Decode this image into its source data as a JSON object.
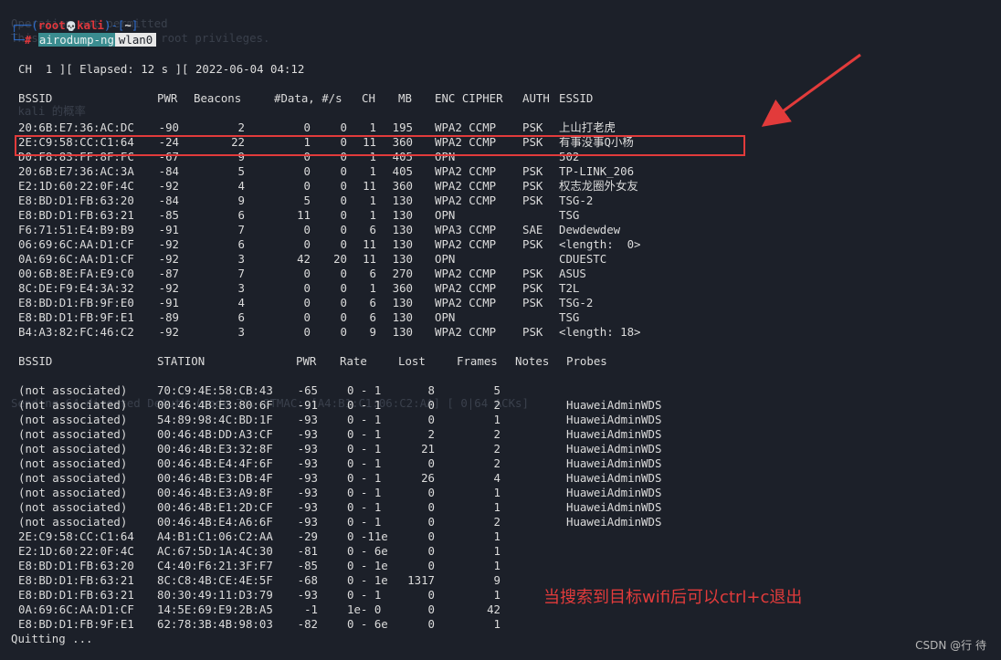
{
  "prompt": {
    "user": "root",
    "skull": "💀",
    "host": "kali",
    "dir": "~",
    "hash": "#",
    "command": "airodump-ng",
    "arg": "wlan0"
  },
  "status_line": "CH  1 ][ Elapsed: 12 s ][ 2022-06-04 04:12",
  "ap_header": [
    "BSSID",
    "PWR",
    "Beacons",
    "#Data, #/s",
    "CH",
    "MB",
    "ENC CIPHER",
    "AUTH",
    "ESSID"
  ],
  "ap_rows": [
    [
      "20:6B:E7:36:AC:DC",
      "-90",
      "2",
      "0",
      "0",
      "1",
      "195",
      "WPA2 CCMP",
      "PSK",
      "上山打老虎"
    ],
    [
      "2E:C9:58:CC:C1:64",
      "-24",
      "22",
      "1",
      "0",
      "11",
      "360",
      "WPA2 CCMP",
      "PSK",
      "有事没事Q小杨"
    ],
    [
      "D0:F8:83:FF:8F:FC",
      "-67",
      "9",
      "0",
      "0",
      "1",
      "405",
      "OPN",
      "",
      "502"
    ],
    [
      "20:6B:E7:36:AC:3A",
      "-84",
      "5",
      "0",
      "0",
      "1",
      "405",
      "WPA2 CCMP",
      "PSK",
      "TP-LINK_206"
    ],
    [
      "E2:1D:60:22:0F:4C",
      "-92",
      "4",
      "0",
      "0",
      "11",
      "360",
      "WPA2 CCMP",
      "PSK",
      "权志龙圈外女友"
    ],
    [
      "E8:BD:D1:FB:63:20",
      "-84",
      "9",
      "5",
      "0",
      "1",
      "130",
      "WPA2 CCMP",
      "PSK",
      "TSG-2"
    ],
    [
      "E8:BD:D1:FB:63:21",
      "-85",
      "6",
      "11",
      "0",
      "1",
      "130",
      "OPN",
      "",
      "TSG"
    ],
    [
      "F6:71:51:E4:B9:B9",
      "-91",
      "7",
      "0",
      "0",
      "6",
      "130",
      "WPA3 CCMP",
      "SAE",
      "Dewdewdew"
    ],
    [
      "06:69:6C:AA:D1:CF",
      "-92",
      "6",
      "0",
      "0",
      "11",
      "130",
      "WPA2 CCMP",
      "PSK",
      "<length:  0>"
    ],
    [
      "0A:69:6C:AA:D1:CF",
      "-92",
      "3",
      "42",
      "20",
      "11",
      "130",
      "OPN",
      "",
      "CDUESTC"
    ],
    [
      "00:6B:8E:FA:E9:C0",
      "-87",
      "7",
      "0",
      "0",
      "6",
      "270",
      "WPA2 CCMP",
      "PSK",
      "ASUS"
    ],
    [
      "8C:DE:F9:E4:3A:32",
      "-92",
      "3",
      "0",
      "0",
      "1",
      "360",
      "WPA2 CCMP",
      "PSK",
      "T2L"
    ],
    [
      "E8:BD:D1:FB:9F:E0",
      "-91",
      "4",
      "0",
      "0",
      "6",
      "130",
      "WPA2 CCMP",
      "PSK",
      "TSG-2"
    ],
    [
      "E8:BD:D1:FB:9F:E1",
      "-89",
      "6",
      "0",
      "0",
      "6",
      "130",
      "OPN",
      "",
      "TSG"
    ],
    [
      "B4:A3:82:FC:46:C2",
      "-92",
      "3",
      "0",
      "0",
      "9",
      "130",
      "WPA2 CCMP",
      "PSK",
      "<length: 18>"
    ]
  ],
  "sta_header": [
    "BSSID",
    "STATION",
    "PWR",
    "Rate",
    "Lost",
    "Frames",
    "Notes",
    "Probes"
  ],
  "sta_rows": [
    [
      "(not associated)",
      "70:C9:4E:58:CB:43",
      "-65",
      "0 - 1",
      "8",
      "5",
      "",
      ""
    ],
    [
      "(not associated)",
      "00:46:4B:E3:80:6F",
      "-91",
      "0 - 1",
      "0",
      "2",
      "",
      "HuaweiAdminWDS"
    ],
    [
      "(not associated)",
      "54:89:98:4C:BD:1F",
      "-93",
      "0 - 1",
      "0",
      "1",
      "",
      "HuaweiAdminWDS"
    ],
    [
      "(not associated)",
      "00:46:4B:DD:A3:CF",
      "-93",
      "0 - 1",
      "2",
      "2",
      "",
      "HuaweiAdminWDS"
    ],
    [
      "(not associated)",
      "00:46:4B:E3:32:8F",
      "-93",
      "0 - 1",
      "21",
      "2",
      "",
      "HuaweiAdminWDS"
    ],
    [
      "(not associated)",
      "00:46:4B:E4:4F:6F",
      "-93",
      "0 - 1",
      "0",
      "2",
      "",
      "HuaweiAdminWDS"
    ],
    [
      "(not associated)",
      "00:46:4B:E3:DB:4F",
      "-93",
      "0 - 1",
      "26",
      "4",
      "",
      "HuaweiAdminWDS"
    ],
    [
      "(not associated)",
      "00:46:4B:E3:A9:8F",
      "-93",
      "0 - 1",
      "0",
      "1",
      "",
      "HuaweiAdminWDS"
    ],
    [
      "(not associated)",
      "00:46:4B:E1:2D:CF",
      "-93",
      "0 - 1",
      "0",
      "1",
      "",
      "HuaweiAdminWDS"
    ],
    [
      "(not associated)",
      "00:46:4B:E4:A6:6F",
      "-93",
      "0 - 1",
      "0",
      "2",
      "",
      "HuaweiAdminWDS"
    ],
    [
      "2E:C9:58:CC:C1:64",
      "A4:B1:C1:06:C2:AA",
      "-29",
      "0 -11e",
      "0",
      "1",
      "",
      ""
    ],
    [
      "E2:1D:60:22:0F:4C",
      "AC:67:5D:1A:4C:30",
      "-81",
      "0 - 6e",
      "0",
      "1",
      "",
      ""
    ],
    [
      "E8:BD:D1:FB:63:20",
      "C4:40:F6:21:3F:F7",
      "-85",
      "0 - 1e",
      "0",
      "1",
      "",
      ""
    ],
    [
      "E8:BD:D1:FB:63:21",
      "8C:C8:4B:CE:4E:5F",
      "-68",
      "0 - 1e",
      "1317",
      "9",
      "",
      ""
    ],
    [
      "E8:BD:D1:FB:63:21",
      "80:30:49:11:D3:79",
      "-93",
      "0 - 1",
      "0",
      "1",
      "",
      ""
    ],
    [
      "0A:69:6C:AA:D1:CF",
      "14:5E:69:E9:2B:A5",
      "-1",
      "1e- 0",
      "0",
      "42",
      "",
      ""
    ],
    [
      "E8:BD:D1:FB:9F:E1",
      "62:78:3B:4B:98:03",
      "-82",
      "0 - 6e",
      "0",
      "1",
      "",
      ""
    ]
  ],
  "quit_line": "Quitting ...",
  "annotation_text": "当搜索到目标wifi后可以ctrl+c退出",
  "watermark": "CSDN @行  待",
  "colors": {
    "background": "#1c2029",
    "text": "#dcdcdc",
    "prompt_red": "#e0373c",
    "prompt_blue": "#2f6fd1",
    "command_highlight": "#3a8c8f",
    "annotation_red": "#e23b3b"
  }
}
